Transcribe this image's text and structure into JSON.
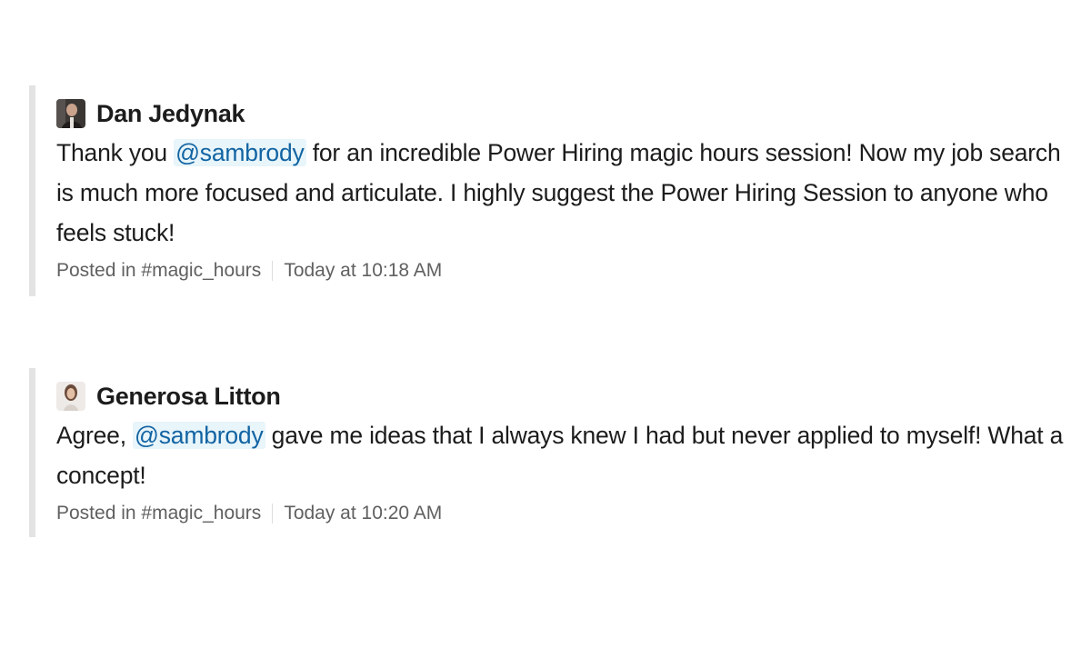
{
  "messages": [
    {
      "author": "Dan Jedynak",
      "avatar_icon": "user-photo-avatar-dark",
      "text_before": "Thank you ",
      "mention": "@sambrody",
      "text_after": " for an incredible Power Hiring magic hours session!  Now my job search is much more focused and articulate. I highly suggest the Power Hiring Session to anyone who feels stuck!",
      "posted_in": "Posted in #magic_hours",
      "timestamp": "Today at 10:18 AM"
    },
    {
      "author": "Generosa Litton",
      "avatar_icon": "user-photo-avatar-light",
      "text_before": "Agree, ",
      "mention": "@sambrody",
      "text_after": " gave me ideas that I always knew I had but never applied to myself!  What a concept!",
      "posted_in": "Posted in #magic_hours",
      "timestamp": "Today at 10:20 AM"
    }
  ],
  "colors": {
    "mention_text": "#1264a3",
    "mention_bg": "#e8f5fa",
    "quote_bar": "#e3e3e3",
    "meta_text": "#616061"
  }
}
